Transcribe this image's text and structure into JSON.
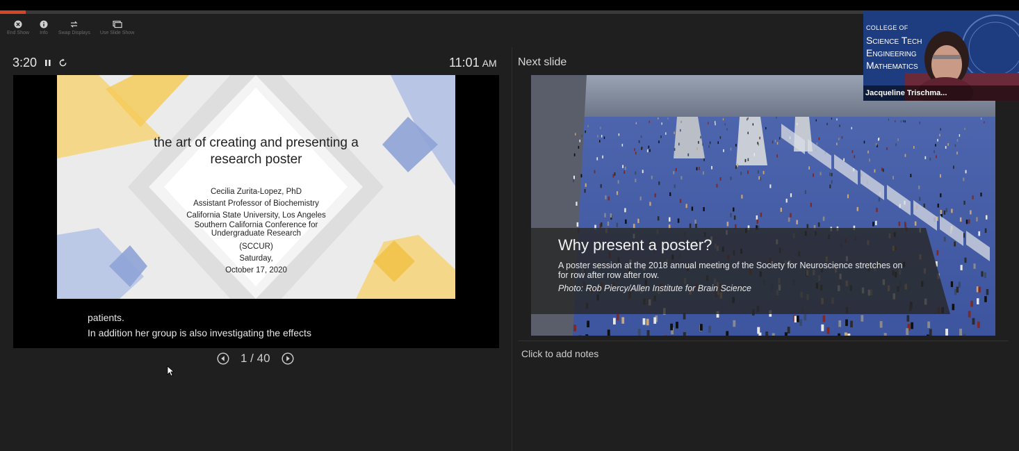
{
  "progress": {
    "fraction": 0.025,
    "color": "#d24726"
  },
  "toolbar": [
    {
      "label": "End Show",
      "icon": "close-circle-icon"
    },
    {
      "label": "Info",
      "icon": "info-icon"
    },
    {
      "label": "Swap Displays",
      "icon": "swap-icon"
    },
    {
      "label": "Use Slide Show",
      "icon": "slideshow-icon"
    }
  ],
  "timer": {
    "elapsed": "3:20",
    "pause_icon": "pause-icon",
    "restart_icon": "restart-icon"
  },
  "clock": {
    "time": "11:01",
    "ampm": "AM"
  },
  "current_slide": {
    "title": "the art of creating and presenting a research poster",
    "lines": [
      "Cecilia Zurita-Lopez, PhD",
      "Assistant Professor of Biochemistry",
      "California State University, Los Angeles",
      "Southern California Conference for",
      "Undergraduate Research",
      "(SCCUR)",
      "Saturday,",
      "October 17, 2020"
    ],
    "accent_colors": [
      "#f5cf6a",
      "#a9b9de",
      "#ffffff"
    ]
  },
  "caption": {
    "line1": "patients.",
    "line2": "In addition her group is also investigating the effects"
  },
  "navigation": {
    "page": "1 / 40",
    "prev_icon": "previous-icon",
    "next_icon": "next-icon"
  },
  "next_slide": {
    "label": "Next slide",
    "title": "Why present a poster?",
    "body": "A poster session at the 2018 annual meeting of the Society for Neuroscience stretches on for row after row after row.",
    "credit": "Photo: Rob Piercy/Allen Institute for Brain Science"
  },
  "notes": {
    "placeholder": "Click to add notes"
  },
  "video": {
    "logo_line1": "COLLEGE OF",
    "logo_line2": "Science Tech",
    "logo_line3": "Engineering",
    "logo_line4": "Mathematics",
    "participant": "Jacqueline Trischma..."
  }
}
